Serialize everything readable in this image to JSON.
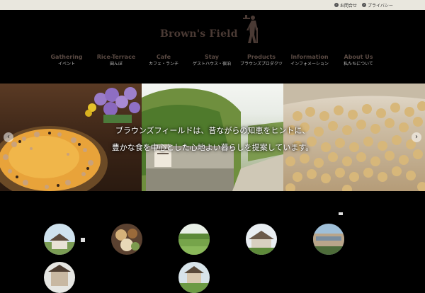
{
  "util": {
    "links": [
      {
        "label": "お問合せ",
        "icon": "arrow-circle-icon"
      },
      {
        "label": "プライバシー",
        "icon": "arrow-circle-icon"
      }
    ]
  },
  "logo": {
    "text": "Brown's Field"
  },
  "nav": {
    "items": [
      {
        "en": "Gathering",
        "jp": "イベント"
      },
      {
        "en": "Rice-Terrace",
        "jp": "田んぼ"
      },
      {
        "en": "Cafe",
        "jp": "カフェ・ランチ"
      },
      {
        "en": "Stay",
        "jp": "ゲストハウス・宿泊"
      },
      {
        "en": "Products",
        "jp": "ブラウンズプロダクツ"
      },
      {
        "en": "Information",
        "jp": "インフォメーション"
      },
      {
        "en": "About Us",
        "jp": "私たちについて"
      }
    ]
  },
  "hero": {
    "caption_line1": "ブラウンズフィールドは、昔ながらの知恵をヒントに、",
    "caption_line2": "豊かな食を中心とした心地よい暮らしを提案しています。"
  },
  "colors": {
    "background": "#000000",
    "utilbar": "#e9e7de",
    "logo": "#4a3a34",
    "nav_en": "#5a4a43"
  }
}
